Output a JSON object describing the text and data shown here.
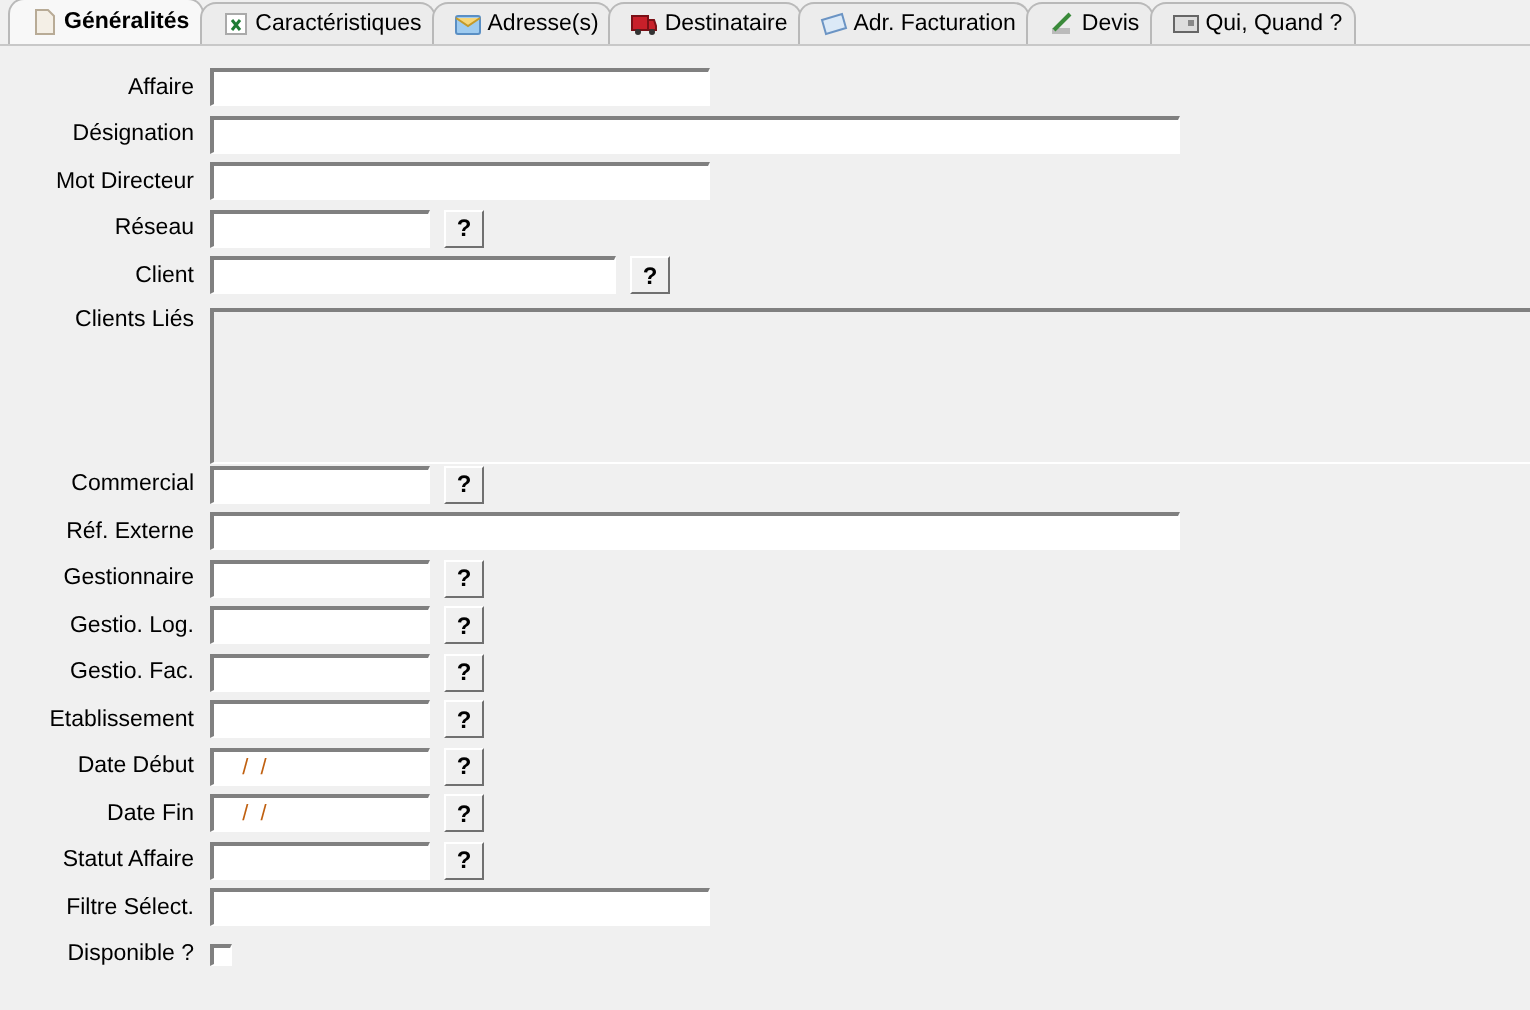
{
  "tabs": [
    {
      "label": "Généralités",
      "selected": true
    },
    {
      "label": "Caractéristiques",
      "selected": false
    },
    {
      "label": "Adresse(s)",
      "selected": false
    },
    {
      "label": "Destinataire",
      "selected": false
    },
    {
      "label": "Adr. Facturation",
      "selected": false
    },
    {
      "label": "Devis",
      "selected": false
    },
    {
      "label": "Qui, Quand ?",
      "selected": false
    }
  ],
  "fields": [
    {
      "label": "Affaire",
      "kind": "text"
    },
    {
      "label": "Désignation",
      "kind": "text"
    },
    {
      "label": "Mot Directeur",
      "kind": "text"
    },
    {
      "label": "Réseau",
      "kind": "text",
      "button": "?"
    },
    {
      "label": "Client",
      "kind": "text",
      "button": "?"
    },
    {
      "label": "Clients Liés",
      "kind": "area"
    },
    {
      "label": "Commercial",
      "kind": "text",
      "button": "?"
    },
    {
      "label": "Réf. Externe",
      "kind": "text"
    },
    {
      "label": "Gestionnaire",
      "kind": "text",
      "button": "?"
    },
    {
      "label": "Gestio. Log.",
      "kind": "text",
      "button": "?"
    },
    {
      "label": "Gestio. Fac.",
      "kind": "text",
      "button": "?"
    },
    {
      "label": "Etablissement",
      "kind": "text",
      "button": "?"
    },
    {
      "label": "Date Début",
      "kind": "text",
      "value": "  /  /",
      "button": "?"
    },
    {
      "label": "Date Fin",
      "kind": "text",
      "value": "  /  /",
      "button": "?"
    },
    {
      "label": "Statut Affaire",
      "kind": "text",
      "button": "?"
    },
    {
      "label": "Filtre Sélect.",
      "kind": "text"
    },
    {
      "label": "Disponible ?",
      "kind": "checkbox",
      "checked": false
    }
  ]
}
